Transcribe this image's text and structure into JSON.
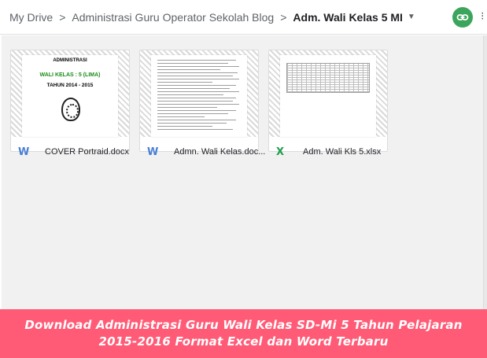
{
  "breadcrumb": {
    "items": [
      "My Drive",
      "Administrasi Guru Operator Sekolah Blog",
      "Adm. Wali Kelas 5 MI"
    ],
    "separator": ">"
  },
  "actions": {
    "get_link_icon": "link-icon",
    "accent_color": "#3ba55c"
  },
  "files": [
    {
      "name": "COVER Portraid.docx",
      "type_icon": "W",
      "icon_name": "word-icon",
      "thumbnail": {
        "line1": "ADMINISTRASI",
        "line2": "WALI KELAS : 5 (LIMA)",
        "line3": "TAHUN 2014 - 2015"
      }
    },
    {
      "name": "Admn. Wali Kelas.doc...",
      "type_icon": "W",
      "icon_name": "word-icon"
    },
    {
      "name": "Adm. Wali Kls 5.xlsx",
      "type_icon": "X",
      "icon_name": "excel-icon"
    }
  ],
  "banner": {
    "line1": "Download Administrasi Guru Wali Kelas SD-Mi 5 Tahun Pelajaran",
    "line2": "2015-2016 Format Excel dan Word Terbaru",
    "background": "#ff5b76"
  }
}
